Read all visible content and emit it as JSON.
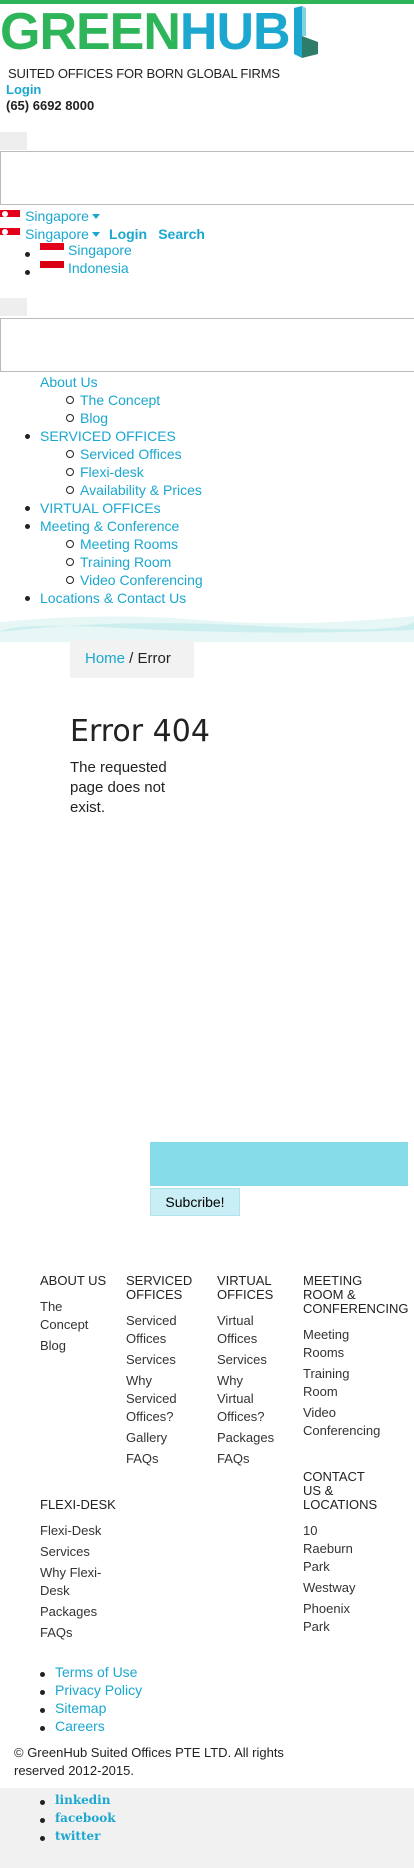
{
  "brand": {
    "green": "GREEN",
    "blue": "HUB",
    "tagline": "SUITED OFFICES FOR BORN GLOBAL FIRMS",
    "accent": "#1ba7cf",
    "green_color": "#2eb55a"
  },
  "header": {
    "login": "Login",
    "phone": "(65) 6692 8000"
  },
  "lang": {
    "current": "Singapore",
    "current_again": "Singapore",
    "login": "Login",
    "search": "Search",
    "options": [
      "Singapore",
      "Indonesia"
    ]
  },
  "nav": {
    "about": "About Us",
    "concept": "The Concept",
    "blog": "Blog",
    "serviced": "SERVICED OFFICES",
    "serviced_offices": "Serviced Offices",
    "flexi": "Flexi-desk",
    "availability": "Availability & Prices",
    "virtual": "VIRTUAL OFFICEs",
    "meeting": "Meeting & Conference",
    "meeting_rooms": "Meeting Rooms",
    "training": "Training Room",
    "video": "Video Conferencing",
    "locations": "Locations & Contact Us"
  },
  "breadcrumb": {
    "home": "Home",
    "sep": " / ",
    "current": "Error"
  },
  "error": {
    "title": "Error 404",
    "message": "The requested page does not exist."
  },
  "subscribe": {
    "button": "Subcribe!"
  },
  "footer": {
    "about": {
      "head": "ABOUT US",
      "links": [
        "The Concept",
        "Blog"
      ]
    },
    "serviced": {
      "head1": "SERVICED",
      "head2": "OFFICES",
      "links": [
        "Serviced Offices",
        "Services",
        "Why Serviced Offices?",
        "Gallery",
        "FAQs"
      ]
    },
    "virtual": {
      "head1": "VIRTUAL",
      "head2": "OFFICES",
      "links": [
        "Virtual Offices",
        "Services",
        "Why Virtual Offices?",
        "Packages",
        "FAQs"
      ]
    },
    "meeting": {
      "head1": "MEETING",
      "head2": "ROOM &",
      "head3": "CONFERENCING",
      "links": [
        "Meeting Rooms",
        "Training Room",
        "Video Conferencing"
      ]
    },
    "contact": {
      "head1": "CONTACT",
      "head2": "US &",
      "head3": "LOCATIONS",
      "links": [
        "10 Raeburn Park",
        "Westway",
        "Phoenix Park"
      ]
    },
    "flexi": {
      "head": "FLEXI-DESK",
      "links": [
        "Flexi-Desk",
        "Services",
        "Why Flexi-Desk",
        "Packages",
        "FAQs"
      ]
    }
  },
  "legal": [
    "Terms of Use",
    "Privacy Policy",
    "Sitemap",
    "Careers"
  ],
  "copyright": "© GreenHub Suited Offices PTE LTD. All rights reserved 2012-2015.",
  "social": [
    "linkedin",
    "facebook",
    "twitter"
  ]
}
